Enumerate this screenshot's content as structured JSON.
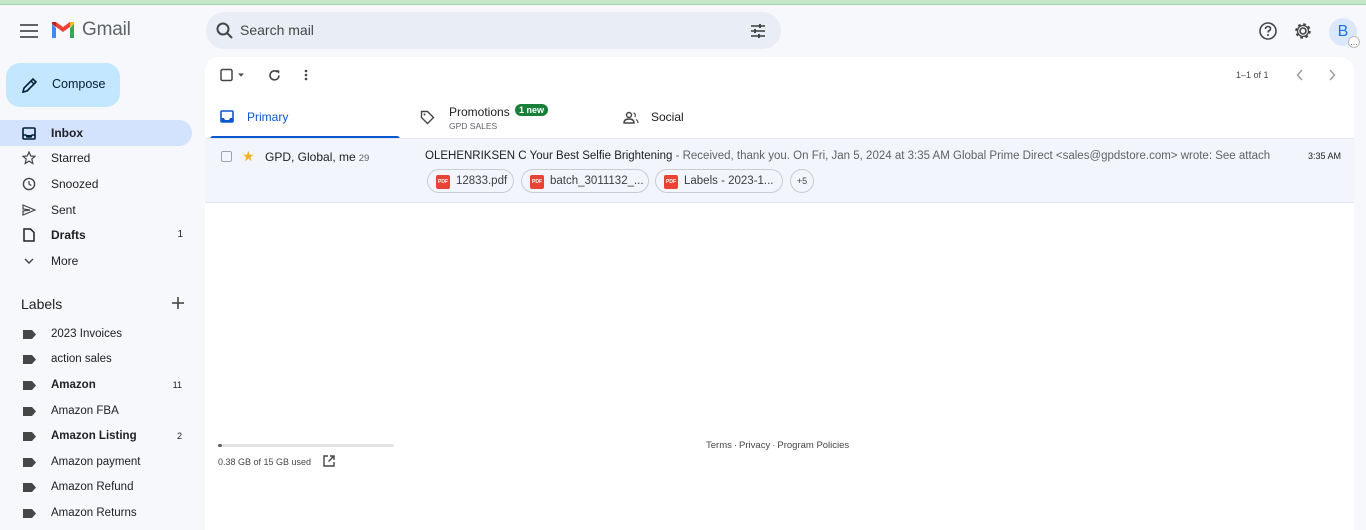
{
  "app": {
    "name": "Gmail"
  },
  "search": {
    "placeholder": "Search mail"
  },
  "header": {
    "avatar_letter": "B",
    "icons": [
      "help-icon",
      "settings-icon"
    ]
  },
  "compose": {
    "label": "Compose"
  },
  "nav": [
    {
      "label": "Inbox",
      "count": "",
      "bold": true,
      "icon": "inbox-icon"
    },
    {
      "label": "Starred",
      "count": "",
      "bold": false,
      "icon": "star-icon"
    },
    {
      "label": "Snoozed",
      "count": "",
      "bold": false,
      "icon": "clock-icon"
    },
    {
      "label": "Sent",
      "count": "",
      "bold": false,
      "icon": "send-icon"
    },
    {
      "label": "Drafts",
      "count": "1",
      "bold": true,
      "icon": "draft-icon"
    },
    {
      "label": "More",
      "count": "",
      "bold": false,
      "icon": "chevron-down-icon"
    }
  ],
  "labels": {
    "heading": "Labels",
    "items": [
      {
        "label": "2023 Invoices",
        "count": "",
        "bold": false
      },
      {
        "label": "action sales",
        "count": "",
        "bold": false
      },
      {
        "label": "Amazon",
        "count": "11",
        "bold": true
      },
      {
        "label": "Amazon FBA",
        "count": "",
        "bold": false
      },
      {
        "label": "Amazon Listing",
        "count": "2",
        "bold": true
      },
      {
        "label": "Amazon payment",
        "count": "",
        "bold": false
      },
      {
        "label": "Amazon Refund",
        "count": "",
        "bold": false
      },
      {
        "label": "Amazon Returns",
        "count": "",
        "bold": false
      }
    ]
  },
  "pager": {
    "text": "1–1 of 1"
  },
  "tabs": {
    "primary": {
      "label": "Primary"
    },
    "promotions": {
      "label": "Promotions",
      "badge": "1 new",
      "sub": "GPD SALES"
    },
    "social": {
      "label": "Social"
    }
  },
  "email": {
    "senders": "GPD, Global, me",
    "count": "29",
    "subject": "OLEHENRIKSEN C Your Best Selfie Brightening",
    "snippet": " - Received, thank you. On Fri, Jan 5, 2024 at 3:35 AM Global Prime Direct <sales@gpdstore.com> wrote: See attached...",
    "time": "3:35 AM",
    "attachments": [
      "12833.pdf",
      "batch_3011132_...",
      "Labels - 2023-1..."
    ],
    "more_attachments": "+5"
  },
  "storage": {
    "text": "0.38 GB of 15 GB used",
    "used_fraction": 0.025
  },
  "footer": {
    "terms": "Terms",
    "privacy": "Privacy",
    "policies": "Program Policies",
    "separator": "·"
  },
  "colors": {
    "accent": "#0b57d0",
    "compose_bg": "#c2e7ff",
    "active_nav": "#d3e3fd",
    "badge_green": "#188038",
    "pdf_red": "#ea4335"
  }
}
